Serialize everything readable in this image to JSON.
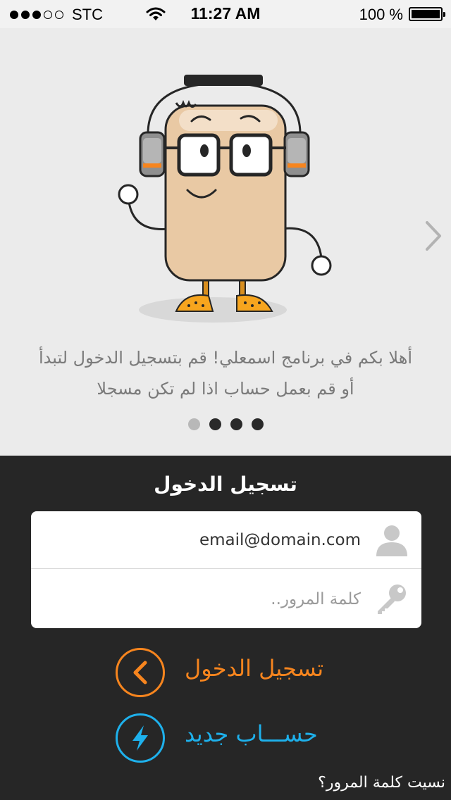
{
  "status_bar": {
    "carrier": "STC",
    "time": "11:27 AM",
    "battery_percent": "100 %",
    "signal_bars_filled": 3,
    "signal_bars_total": 5
  },
  "onboarding": {
    "illustration": "headphones-mascot",
    "welcome_line1": "أهلا بكم في برنامج اسمعلي! قم بتسجيل الدخول لتبدأ",
    "welcome_line2": "أو قم بعمل حساب اذا لم تكن مسجلا",
    "next_icon": "chevron-right-icon",
    "page_count": 4,
    "current_page": 1
  },
  "login": {
    "title": "تسجيل الدخول",
    "email_value": "email@domain.com",
    "email_icon": "user-icon",
    "password_placeholder": "كلمة المرور..",
    "password_icon": "key-icon",
    "signin_label": "تسجيل الدخول",
    "signin_icon": "chevron-left-icon",
    "register_label": "حســـاب جديد",
    "register_icon": "lightning-icon",
    "forgot_label": "نسيت كلمة المرور؟"
  },
  "colors": {
    "accent_orange": "#f7851e",
    "accent_blue": "#1eb1ec",
    "login_bg": "#262626",
    "onboard_bg": "#ebebeb"
  }
}
